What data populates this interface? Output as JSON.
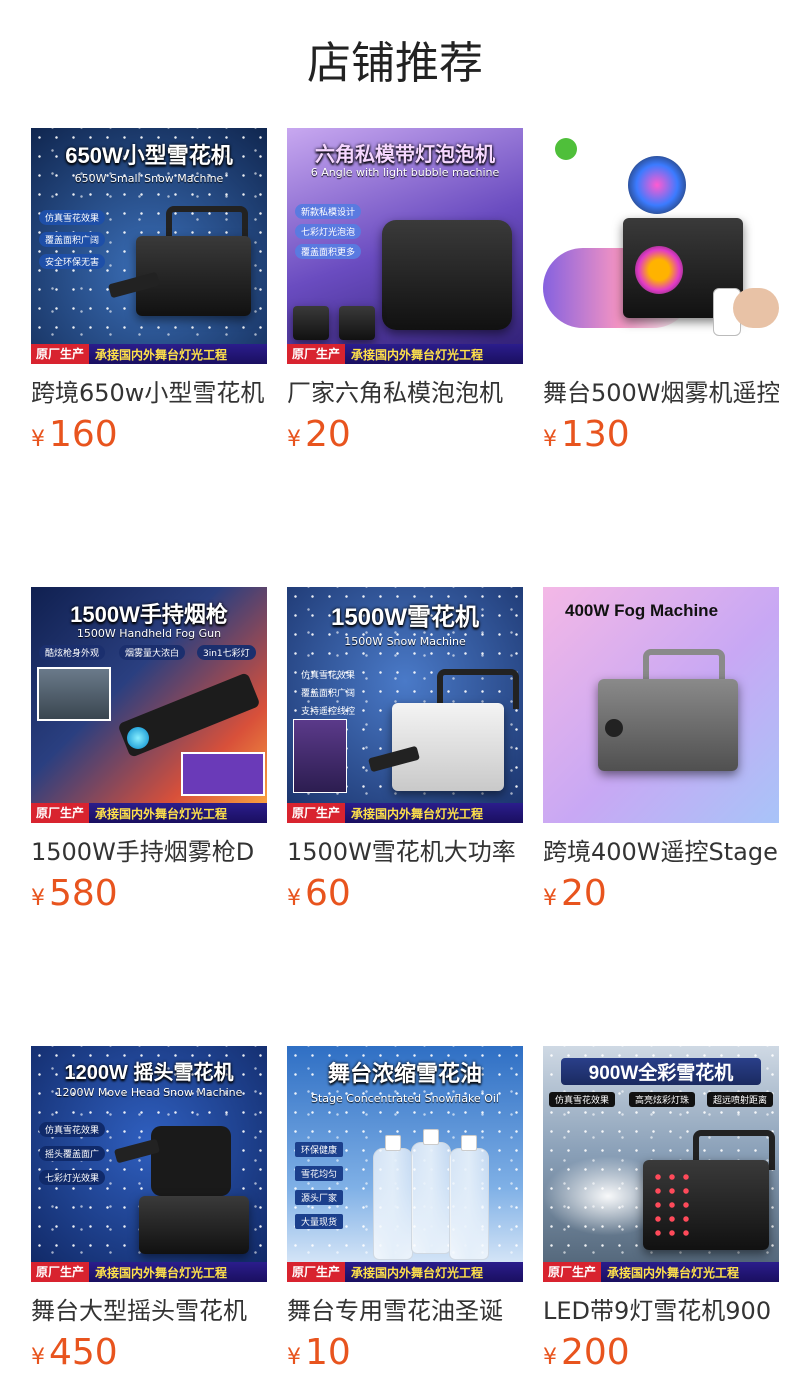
{
  "section_title": "店铺推荐",
  "products": [
    {
      "title": "跨境650w小型雪花机",
      "price": "160",
      "currency": "¥",
      "image": {
        "headline": "650W小型雪花机",
        "subline": "650W Small Snow Machine",
        "features": [
          "仿真雪花效果",
          "覆盖面积广阔",
          "安全环保无害"
        ],
        "banner_tag": "原厂生产",
        "banner_text": "承接国内外舞台灯光工程",
        "bg": "#1c3f7a"
      }
    },
    {
      "title": "厂家六角私模泡泡机",
      "price": "20",
      "currency": "¥",
      "image": {
        "headline": "六角私模带灯泡泡机",
        "subline": "6 Angle with light bubble machine",
        "features": [
          "新款私模设计",
          "七彩灯光泡泡",
          "覆盖面积更多"
        ],
        "banner_tag": "原厂生产",
        "banner_text": "承接国内外舞台灯光工程",
        "bg": "#7b5fc9"
      }
    },
    {
      "title": "舞台500W烟雾机遥控",
      "price": "130",
      "currency": "¥",
      "image": {
        "headline": "",
        "subline": "",
        "features": [],
        "banner_tag": "",
        "banner_text": "",
        "bg": "#ffffff"
      }
    },
    {
      "title": "1500W手持烟雾枪D",
      "price": "580",
      "currency": "¥",
      "image": {
        "headline": "1500W手持烟枪",
        "subline": "1500W Handheld Fog Gun",
        "features": [
          "酷炫枪身外观",
          "烟雾量大浓白",
          "3in1七彩灯"
        ],
        "banner_tag": "原厂生产",
        "banner_text": "承接国内外舞台灯光工程",
        "bg": "#1d2a55"
      }
    },
    {
      "title": "1500W雪花机大功率",
      "price": "60",
      "currency": "¥",
      "image": {
        "headline": "1500W雪花机",
        "subline": "1500W Snow Machine",
        "features": [
          "仿真雪花效果",
          "覆盖面积广阔",
          "支持遥控线控"
        ],
        "banner_tag": "原厂生产",
        "banner_text": "承接国内外舞台灯光工程",
        "bg": "#2a4d8f"
      }
    },
    {
      "title": "跨境400W遥控Stage",
      "price": "20",
      "currency": "¥",
      "image": {
        "headline": "400W Fog Machine",
        "subline": "",
        "features": [],
        "banner_tag": "",
        "banner_text": "",
        "bg": "#d7a9f0"
      }
    },
    {
      "title": "舞台大型摇头雪花机",
      "price": "450",
      "currency": "¥",
      "image": {
        "headline": "1200W 摇头雪花机",
        "subline": "1200W Move Head Snow Machine",
        "features": [
          "仿真雪花效果",
          "摇头覆盖面广",
          "七彩灯光效果"
        ],
        "banner_tag": "原厂生产",
        "banner_text": "承接国内外舞台灯光工程",
        "bg": "#1b3c86"
      }
    },
    {
      "title": "舞台专用雪花油圣诞",
      "price": "10",
      "currency": "¥",
      "image": {
        "headline": "舞台浓缩雪花油",
        "subline": "Stage Concentrated Snowflake Oil",
        "features": [
          "环保健康",
          "雪花均匀",
          "源头厂家",
          "大量现货"
        ],
        "banner_tag": "原厂生产",
        "banner_text": "承接国内外舞台灯光工程",
        "bg": "#3f79c2"
      }
    },
    {
      "title": "LED带9灯雪花机900",
      "price": "200",
      "currency": "¥",
      "image": {
        "headline": "900W全彩雪花机",
        "subline": "",
        "features": [
          "仿真雪花效果",
          "高亮炫彩灯珠",
          "超远喷射距离"
        ],
        "banner_tag": "原厂生产",
        "banner_text": "承接国内外舞台灯光工程",
        "bg": "#8aa0b8"
      }
    }
  ]
}
